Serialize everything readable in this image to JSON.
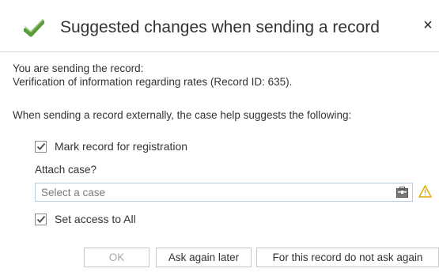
{
  "dialog": {
    "title": "Suggested changes when sending a record",
    "close_glyph": "×",
    "icon": "checkmark-icon",
    "accent_color": "#5a9c3b"
  },
  "body": {
    "line1": "You are sending the record:",
    "line2": "Verification of information regarding rates (Record ID: 635).",
    "line3": "When sending a record externally, the case help suggests the following:"
  },
  "options": {
    "mark_registration": {
      "label": "Mark record for registration",
      "checked": true
    },
    "attach_case_label": "Attach case?",
    "case_input": {
      "placeholder": "Select a case",
      "value": ""
    },
    "set_access": {
      "label": "Set access to All",
      "checked": true
    }
  },
  "buttons": {
    "ok": "OK",
    "ask_later": "Ask again later",
    "never_ask": "For this record do not ask again"
  },
  "colors": {
    "warning": "#e0a800",
    "input_border": "#b5cbe6"
  }
}
